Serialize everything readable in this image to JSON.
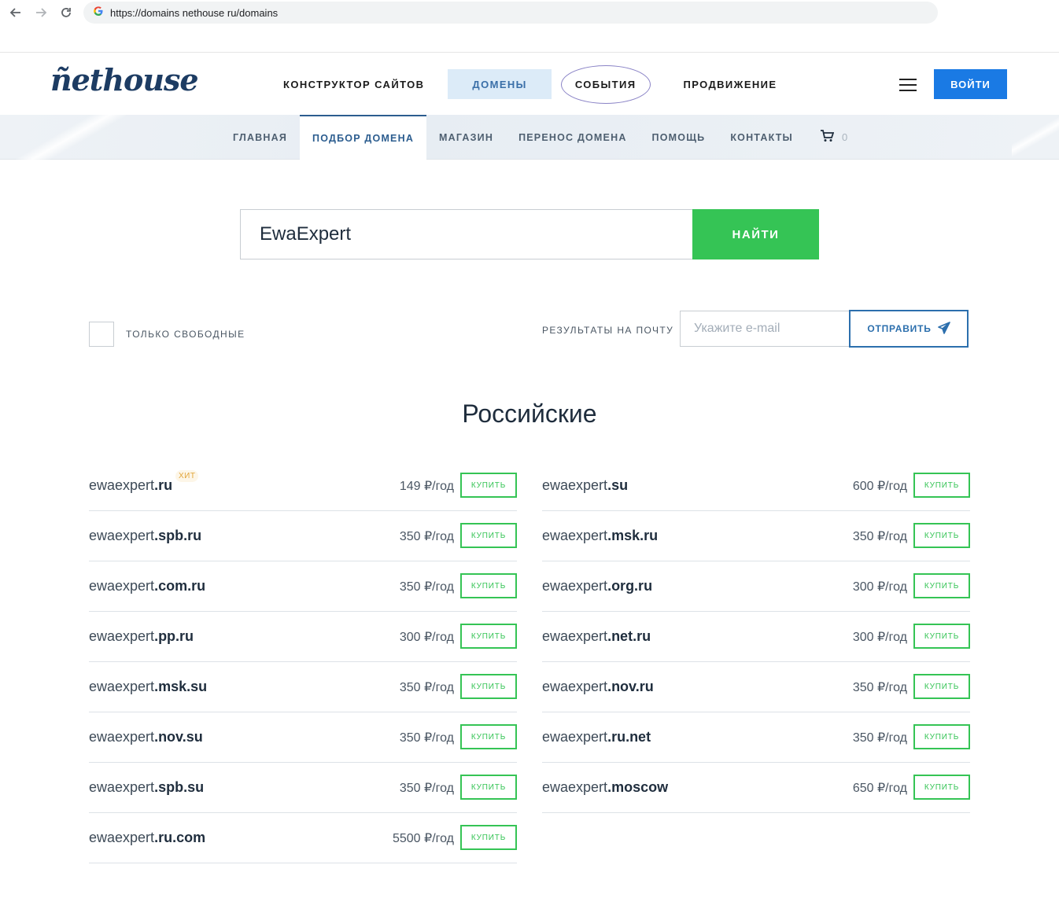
{
  "browser": {
    "url": "https://domains nethouse ru/domains"
  },
  "header": {
    "logo": "ñethouse",
    "nav": [
      "КОНСТРУКТОР САЙТОВ",
      "ДОМЕНЫ",
      "СОБЫТИЯ",
      "ПРОДВИЖЕНИЕ"
    ],
    "active_nav": "ДОМЕНЫ",
    "login_label": "ВОЙТИ"
  },
  "subnav": {
    "items": [
      "ГЛАВНАЯ",
      "ПОДБОР ДОМЕНА",
      "МАГАЗИН",
      "ПЕРЕНОС ДОМЕНА",
      "ПОМОЩЬ",
      "КОНТАКТЫ"
    ],
    "active": "ПОДБОР ДОМЕНА",
    "cart_count": "0"
  },
  "search": {
    "value": "EwaExpert",
    "button_label": "НАЙТИ"
  },
  "filters": {
    "only_free_label": "ТОЛЬКО СВОБОДНЫЕ",
    "email_label": "РЕЗУЛЬТАТЫ НА ПОЧТУ",
    "email_placeholder": "Укажите e-mail",
    "send_label": "ОТПРАВИТЬ"
  },
  "section_title": "Российские",
  "buy_label": "КУПИТЬ",
  "hit_label": "ХИТ",
  "domains_left": [
    {
      "base": "ewaexpert",
      "zone": ".ru",
      "price": "149 ₽/год",
      "hit": true
    },
    {
      "base": "ewaexpert",
      "zone": ".spb.ru",
      "price": "350 ₽/год"
    },
    {
      "base": "ewaexpert",
      "zone": ".com.ru",
      "price": "350 ₽/год"
    },
    {
      "base": "ewaexpert",
      "zone": ".pp.ru",
      "price": "300 ₽/год"
    },
    {
      "base": "ewaexpert",
      "zone": ".msk.su",
      "price": "350 ₽/год"
    },
    {
      "base": "ewaexpert",
      "zone": ".nov.su",
      "price": "350 ₽/год"
    },
    {
      "base": "ewaexpert",
      "zone": ".spb.su",
      "price": "350 ₽/год"
    },
    {
      "base": "ewaexpert",
      "zone": ".ru.com",
      "price": "5500 ₽/год"
    }
  ],
  "domains_right": [
    {
      "base": "ewaexpert",
      "zone": ".su",
      "price": "600 ₽/год"
    },
    {
      "base": "ewaexpert",
      "zone": ".msk.ru",
      "price": "350 ₽/год"
    },
    {
      "base": "ewaexpert",
      "zone": ".org.ru",
      "price": "300 ₽/год"
    },
    {
      "base": "ewaexpert",
      "zone": ".net.ru",
      "price": "300 ₽/год"
    },
    {
      "base": "ewaexpert",
      "zone": ".nov.ru",
      "price": "350 ₽/год"
    },
    {
      "base": "ewaexpert",
      "zone": ".ru.net",
      "price": "350 ₽/год"
    },
    {
      "base": "ewaexpert",
      "zone": ".moscow",
      "price": "650 ₽/год"
    }
  ]
}
